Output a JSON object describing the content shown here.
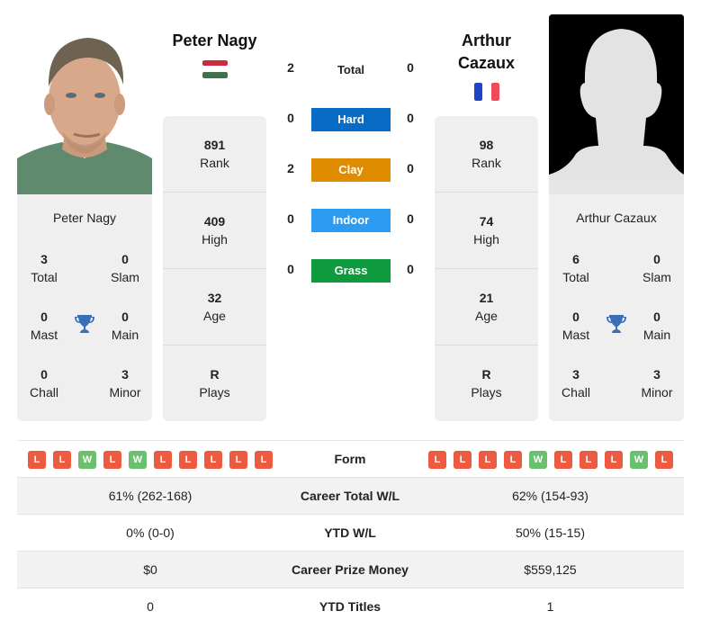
{
  "players": {
    "left": {
      "name": "Peter Nagy",
      "country_flag": "hungary-flag",
      "flag_colors": [
        "#cd2a3e",
        "#ffffff",
        "#436f4d"
      ],
      "titles": {
        "total": {
          "value": "3",
          "label": "Total"
        },
        "slam": {
          "value": "0",
          "label": "Slam"
        },
        "mast": {
          "value": "0",
          "label": "Mast"
        },
        "main": {
          "value": "0",
          "label": "Main"
        },
        "chall": {
          "value": "0",
          "label": "Chall"
        },
        "minor": {
          "value": "3",
          "label": "Minor"
        }
      },
      "stats": [
        {
          "value": "891",
          "label": "Rank"
        },
        {
          "value": "409",
          "label": "High"
        },
        {
          "value": "32",
          "label": "Age"
        },
        {
          "value": "R",
          "label": "Plays"
        }
      ],
      "form": [
        "L",
        "L",
        "W",
        "L",
        "W",
        "L",
        "L",
        "L",
        "L",
        "L"
      ]
    },
    "right": {
      "name": "Arthur Cazaux",
      "name_line1": "Arthur",
      "name_line2": "Cazaux",
      "country_flag": "france-flag",
      "flag_colors": [
        "#0055a4",
        "#ffffff",
        "#ef4135"
      ],
      "titles": {
        "total": {
          "value": "6",
          "label": "Total"
        },
        "slam": {
          "value": "0",
          "label": "Slam"
        },
        "mast": {
          "value": "0",
          "label": "Mast"
        },
        "main": {
          "value": "0",
          "label": "Main"
        },
        "chall": {
          "value": "3",
          "label": "Chall"
        },
        "minor": {
          "value": "3",
          "label": "Minor"
        }
      },
      "stats": [
        {
          "value": "98",
          "label": "Rank"
        },
        {
          "value": "74",
          "label": "High"
        },
        {
          "value": "21",
          "label": "Age"
        },
        {
          "value": "R",
          "label": "Plays"
        }
      ],
      "form": [
        "L",
        "L",
        "L",
        "L",
        "W",
        "L",
        "L",
        "L",
        "W",
        "L"
      ]
    }
  },
  "h2h": {
    "total": {
      "label": "Total",
      "left": "2",
      "right": "0"
    },
    "surfaces": [
      {
        "label": "Hard",
        "left": "0",
        "right": "0",
        "color": "#0a6bc4"
      },
      {
        "label": "Clay",
        "left": "2",
        "right": "0",
        "color": "#e08c00"
      },
      {
        "label": "Indoor",
        "left": "0",
        "right": "0",
        "color": "#2d9bf0"
      },
      {
        "label": "Grass",
        "left": "0",
        "right": "0",
        "color": "#0f9a3e"
      }
    ]
  },
  "form_label": "Form",
  "form_colors": {
    "W": "#6cbf6c",
    "L": "#ec5a41"
  },
  "comparison": [
    {
      "label": "Career Total W/L",
      "left": "61% (262-168)",
      "right": "62% (154-93)"
    },
    {
      "label": "YTD W/L",
      "left": "0% (0-0)",
      "right": "50% (15-15)"
    },
    {
      "label": "Career Prize Money",
      "left": "$0",
      "right": "$559,125"
    },
    {
      "label": "YTD Titles",
      "left": "0",
      "right": "1"
    }
  ]
}
